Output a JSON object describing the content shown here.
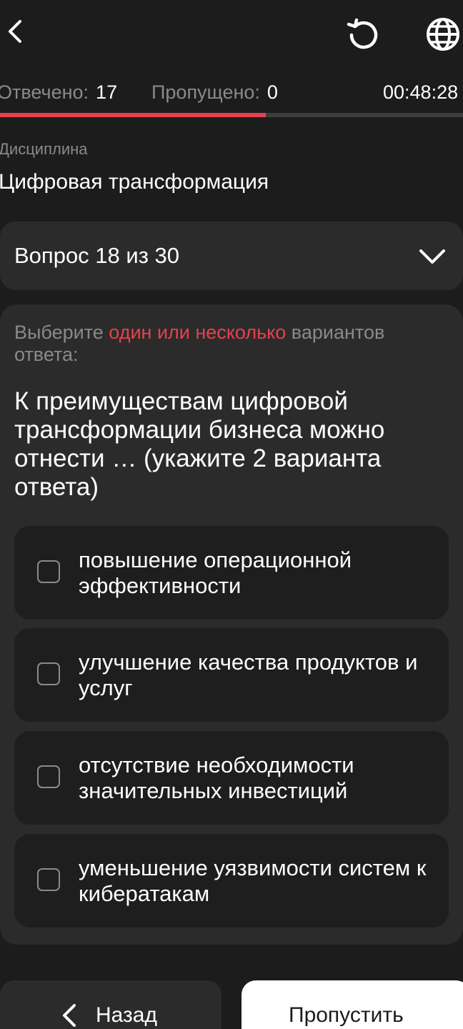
{
  "colors": {
    "background": "#1c1c1c",
    "card": "#2b2b2b",
    "option": "#1e1e1e",
    "accent": "#e8404c",
    "muted": "#8a8a8a"
  },
  "header": {
    "back_icon": "chevron-left-icon",
    "reload_icon": "reload-icon",
    "language_icon": "globe-icon"
  },
  "stats": {
    "answered_label": "Отвечено:",
    "answered_value": "17",
    "skipped_label": "Пропущено:",
    "skipped_value": "0",
    "timer": "00:48:28"
  },
  "progress": {
    "answered": 17,
    "total": 30,
    "fraction": 0.574
  },
  "discipline": {
    "label": "Дисциплина",
    "value": "Цифровая трансформация"
  },
  "question_selector": {
    "label": "Вопрос 18 из 30",
    "icon": "chevron-down-icon"
  },
  "question": {
    "instruction_prefix": "Выберите ",
    "instruction_accent": "один или несколько",
    "instruction_suffix": " вариантов ответа:",
    "text": "К преимуществам цифровой трансформации бизнеса можно отнести … (укажите 2 варианта ответа)",
    "options": [
      {
        "label": "повышение операционной эффективности",
        "checked": false
      },
      {
        "label": "улучшение качества продуктов и услуг",
        "checked": false
      },
      {
        "label": "отсутствие необходимости значительных инвестиций",
        "checked": false
      },
      {
        "label": "уменьшение уязвимости систем к кибератакам",
        "checked": false
      }
    ]
  },
  "footer": {
    "back_label": "Назад",
    "skip_label": "Пропустить"
  }
}
